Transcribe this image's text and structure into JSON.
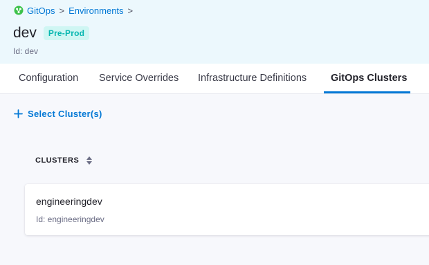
{
  "breadcrumb": {
    "items": [
      {
        "label": "GitOps",
        "icon": "gitops-icon"
      },
      {
        "label": "Environments"
      }
    ],
    "separator": ">"
  },
  "environment": {
    "name": "dev",
    "badge": "Pre-Prod",
    "id_text": "Id: dev"
  },
  "tabs": [
    {
      "label": "Configuration",
      "active": false
    },
    {
      "label": "Service Overrides",
      "active": false
    },
    {
      "label": "Infrastructure Definitions",
      "active": false
    },
    {
      "label": "GitOps Clusters",
      "active": true
    }
  ],
  "actions": {
    "select_clusters_label": "Select Cluster(s)",
    "icon": "plus-icon"
  },
  "table": {
    "column_header": "CLUSTERS",
    "sort_icon": "sort-icon",
    "rows": [
      {
        "name": "engineeringdev",
        "id_text": "Id: engineeringdev"
      }
    ]
  },
  "colors": {
    "accent": "#0278d5",
    "header_bg": "#ecf8fd",
    "badge_bg": "#cff6f3",
    "badge_text": "#06b7b0",
    "gitops_icon": "#3dc24b"
  }
}
